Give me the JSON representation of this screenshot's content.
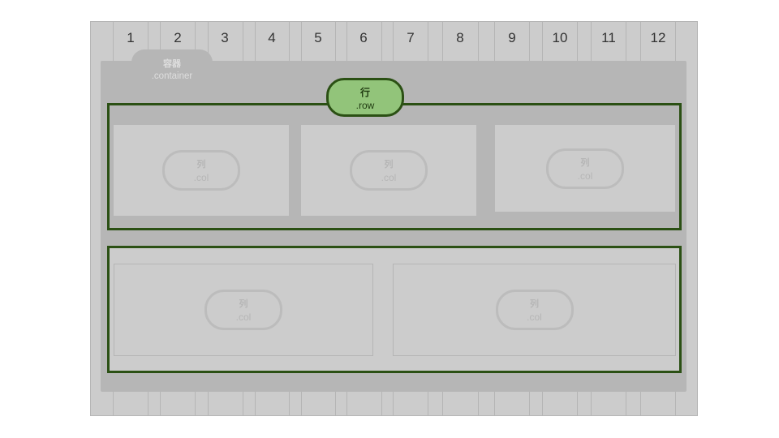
{
  "grid": {
    "columns": [
      "1",
      "2",
      "3",
      "4",
      "5",
      "6",
      "7",
      "8",
      "9",
      "10",
      "11",
      "12"
    ]
  },
  "container": {
    "label_cn": "容器",
    "label_class": ".container"
  },
  "row": {
    "label_cn": "行",
    "label_class": ".row"
  },
  "rows": [
    {
      "cols": [
        {
          "label_cn": "列",
          "label_class": ".col"
        },
        {
          "label_cn": "列",
          "label_class": ".col"
        },
        {
          "label_cn": "列",
          "label_class": ".col"
        }
      ]
    },
    {
      "cols": [
        {
          "label_cn": "列",
          "label_class": ".col"
        },
        {
          "label_cn": "列",
          "label_class": ".col"
        }
      ]
    }
  ],
  "colors": {
    "row_border": "#2b5014",
    "row_pill_fill": "#92c47a",
    "container_fill": "#b6b6b6",
    "grid_fill": "#cccccc"
  }
}
